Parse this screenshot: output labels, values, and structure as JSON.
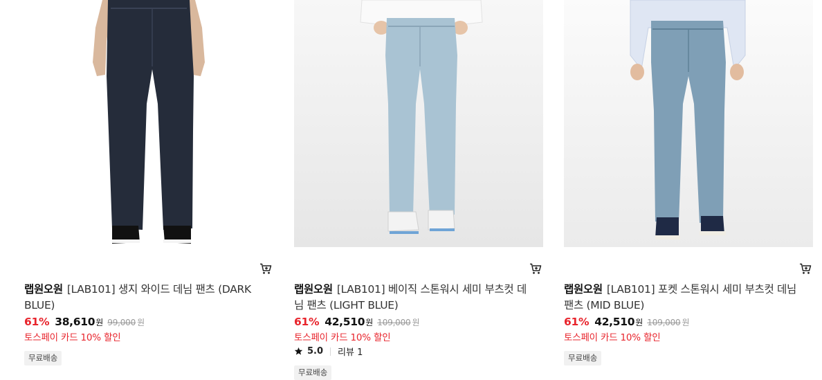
{
  "products": [
    {
      "image_alt": "",
      "brand": "랩원오원",
      "name": "[LAB101] 생지 와이드 데님 팬츠 (DARK BLUE)",
      "discount": "61%",
      "price": "38,610",
      "currency": "원",
      "original_price": "99,000",
      "promo": "토스페이 카드 10% 할인",
      "badge": "무료배송",
      "denim_color": "#252c3a",
      "shoe_color": "#111111"
    },
    {
      "image_alt": "",
      "brand": "랩원오원",
      "name": "[LAB101] 베이직 스톤워시 세미 부츠컷 데님 팬츠 (LIGHT BLUE)",
      "discount": "61%",
      "price": "42,510",
      "currency": "원",
      "original_price": "109,000",
      "promo": "토스페이 카드 10% 할인",
      "rating": "5.0",
      "reviews": "리뷰 1",
      "badge": "무료배송",
      "denim_color": "#a9c3d3",
      "shoe_color": "#f3f3f3"
    },
    {
      "image_alt": "",
      "brand": "랩원오원",
      "name": "[LAB101] 포켓 스톤워시 세미 부츠컷 데님 팬츠 (MID BLUE)",
      "discount": "61%",
      "price": "42,510",
      "currency": "원",
      "original_price": "109,000",
      "promo": "토스페이 카드 10% 할인",
      "badge": "무료배송",
      "denim_color": "#7f9fb6",
      "shoe_color": "#1f2a45"
    }
  ],
  "colors": {
    "accent_red": "#e8242c",
    "badge_bg": "#f1f1f1",
    "muted_text": "#999999"
  },
  "icons": {
    "cart": "cart-plus-icon",
    "star": "star-icon"
  }
}
